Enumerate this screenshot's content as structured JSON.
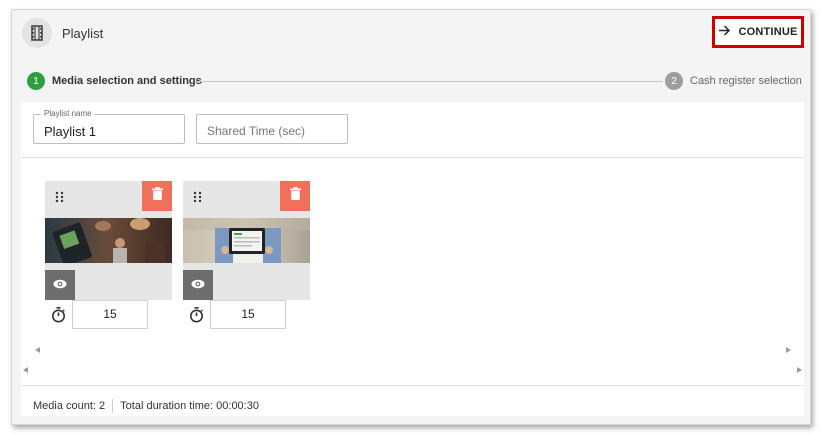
{
  "header": {
    "title": "Playlist",
    "icon": "film-icon",
    "continue_label": "CONTINUE",
    "continue_icon": "arrow-right-icon"
  },
  "stepper": {
    "steps": [
      {
        "number": "1",
        "label": "Media selection and settings",
        "state": "active",
        "color": "#2e9e3e"
      },
      {
        "number": "2",
        "label": "Cash register selection",
        "state": "inactive",
        "color": "#9e9e9e"
      }
    ]
  },
  "form": {
    "playlist_name": {
      "label": "Playlist name",
      "value": "Playlist 1"
    },
    "shared_time": {
      "placeholder": "Shared Time (sec)",
      "value": ""
    }
  },
  "media": [
    {
      "thumbnail": "handheld-device-in-cafe",
      "duration": "15",
      "icons": [
        "drag-handle-icon",
        "trash-icon",
        "eye-icon",
        "stopwatch-icon"
      ]
    },
    {
      "thumbnail": "person-holding-tablet",
      "duration": "15",
      "icons": [
        "drag-handle-icon",
        "trash-icon",
        "eye-icon",
        "stopwatch-icon"
      ]
    }
  ],
  "footer": {
    "media_count": "Media count: 2",
    "total_duration": "Total duration time: 00:00:30"
  },
  "colors": {
    "accent_green": "#2e9e3e",
    "delete_red": "#f0705c",
    "highlight_red": "#cc0000",
    "preview_gray": "#6d6d6d"
  }
}
